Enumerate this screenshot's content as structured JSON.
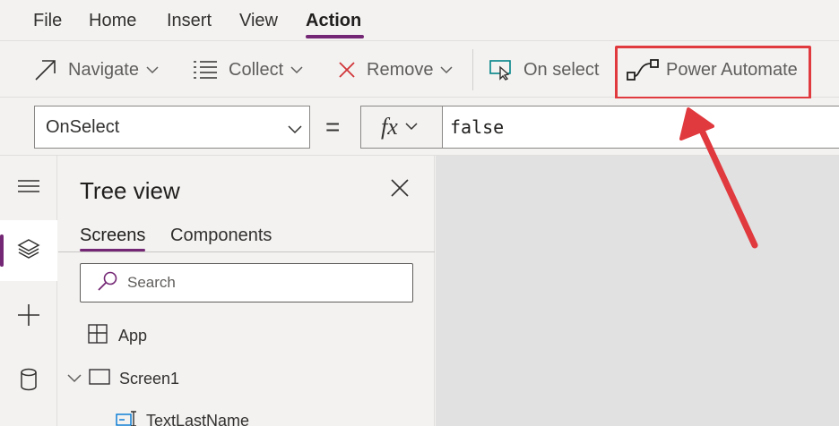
{
  "menu": {
    "items": [
      {
        "label": "File"
      },
      {
        "label": "Home"
      },
      {
        "label": "Insert"
      },
      {
        "label": "View"
      },
      {
        "label": "Action"
      }
    ],
    "active": "Action"
  },
  "ribbon": {
    "navigate": "Navigate",
    "collect": "Collect",
    "remove": "Remove",
    "on_select": "On select",
    "power_automate": "Power Automate"
  },
  "formula": {
    "property": "OnSelect",
    "equals": "=",
    "fx": "fx",
    "value": "false"
  },
  "tree": {
    "title": "Tree view",
    "tabs": [
      {
        "label": "Screens"
      },
      {
        "label": "Components"
      }
    ],
    "search_placeholder": "Search",
    "items": [
      {
        "label": "App"
      },
      {
        "label": "Screen1"
      },
      {
        "label": "TextLastName"
      }
    ]
  },
  "colors": {
    "accent": "#742774",
    "highlight": "#e0393e"
  },
  "icons": {
    "navigate": "arrow-up-right-icon",
    "collect": "list-icon",
    "remove": "close-x-icon",
    "on_select": "cursor-select-icon",
    "power_automate": "flow-icon"
  }
}
